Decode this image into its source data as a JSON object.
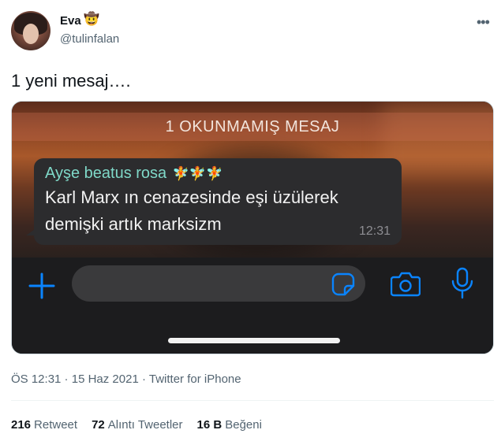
{
  "author": {
    "display_name": "Eva",
    "display_name_emoji": "🤠",
    "handle": "@tulinfalan"
  },
  "tweet": {
    "text": "1 yeni mesaj…."
  },
  "media": {
    "unread_banner": "1 OKUNMAMIŞ MESAJ",
    "sender": "Ayşe beatus rosa",
    "sender_emojis": "🧚🧚🧚",
    "message_lines": [
      "Karl Marx ın cenazesinde eşi üzülerek",
      "demişki artık marksizm"
    ],
    "message_time": "12:31",
    "icons": [
      "plus-icon",
      "sticker-icon",
      "camera-icon",
      "microphone-icon"
    ],
    "colors": {
      "accent_blue": "#0a84ff",
      "sender_teal": "#7fd8c8",
      "bubble": "#2c2c2e"
    }
  },
  "meta": {
    "time": "ÖS 12:31",
    "sep1": " · ",
    "date": "15 Haz 2021",
    "sep2": " · ",
    "source": "Twitter for iPhone"
  },
  "stats": {
    "retweets_count": "216",
    "retweets_label": "Retweet",
    "quotes_count": "72",
    "quotes_label": "Alıntı Tweetler",
    "likes_count": "16 B",
    "likes_label": "Beğeni"
  }
}
